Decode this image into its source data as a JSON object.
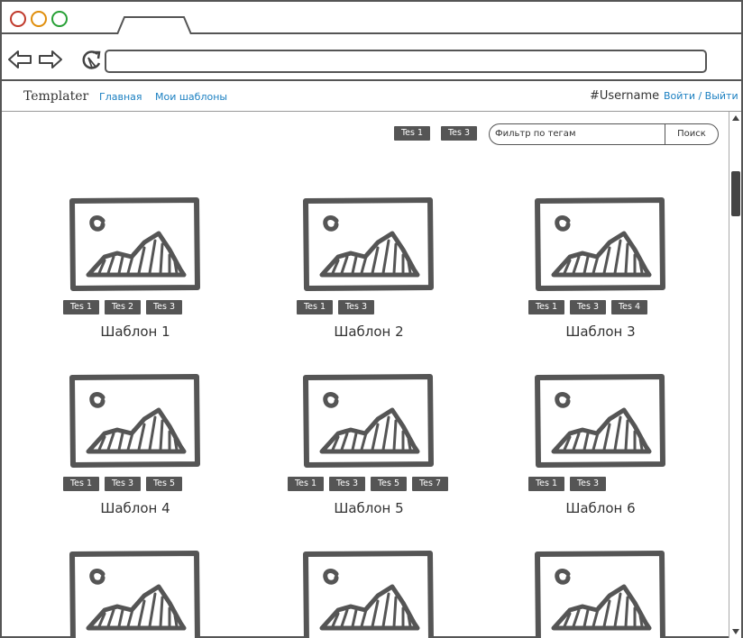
{
  "app": {
    "brand": "Templater",
    "nav": [
      "Главная",
      "Мои шаблоны"
    ],
    "username": "#Username",
    "login": "Войти / Выйти"
  },
  "filter": {
    "active_tags": [
      "Tes 1",
      "Tes 3"
    ],
    "placeholder": "Фильтр по тегам",
    "button": "Поиск"
  },
  "templates": [
    {
      "title": "Шаблон 1",
      "tags": [
        "Tes 1",
        "Tes 2",
        "Tes 3"
      ]
    },
    {
      "title": "Шаблон 2",
      "tags": [
        "Tes 1",
        "Tes 3"
      ]
    },
    {
      "title": "Шаблон 3",
      "tags": [
        "Tes 1",
        "Tes 3",
        "Tes 4"
      ]
    },
    {
      "title": "Шаблон 4",
      "tags": [
        "Tes 1",
        "Tes 3",
        "Tes 5"
      ]
    },
    {
      "title": "Шаблон 5",
      "tags": [
        "Tes 1",
        "Tes 3",
        "Tes 5",
        "Tes 7"
      ]
    },
    {
      "title": "Шаблон 6",
      "tags": [
        "Tes 1",
        "Tes 3"
      ]
    },
    {
      "title": "",
      "tags": []
    },
    {
      "title": "",
      "tags": []
    },
    {
      "title": "",
      "tags": []
    }
  ],
  "colors": {
    "accent": "#1a7fc1",
    "ink": "#555555",
    "dot_red": "#c0392b",
    "dot_orange": "#e08e0b",
    "dot_green": "#27a036"
  }
}
